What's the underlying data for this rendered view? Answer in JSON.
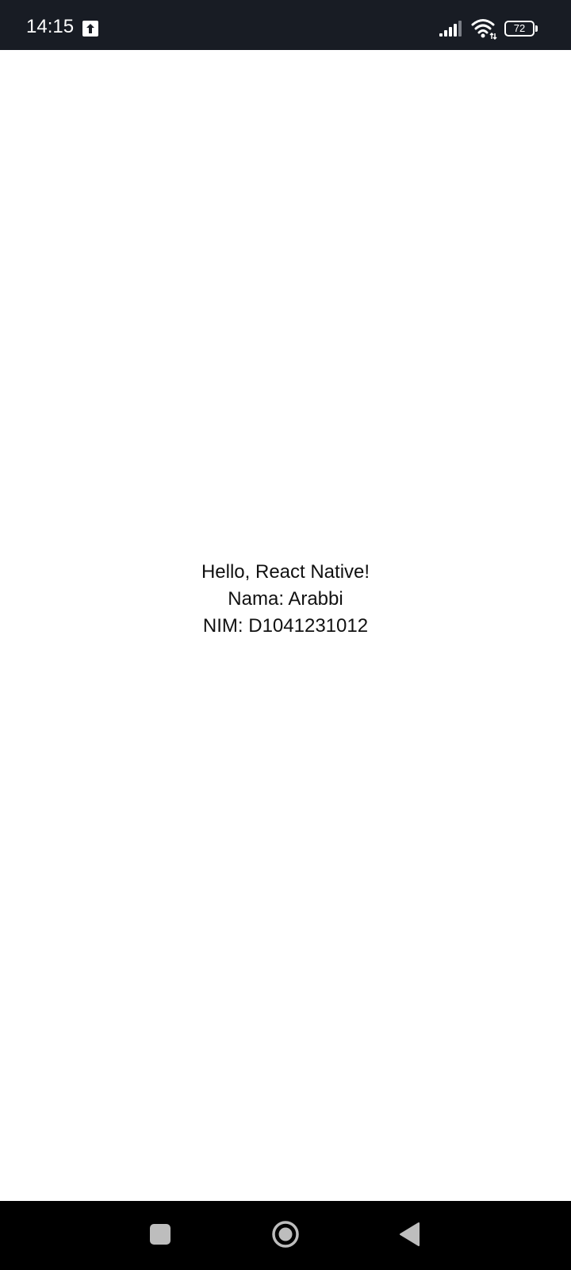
{
  "status_bar": {
    "time": "14:15",
    "battery_level": "72",
    "icons": [
      "upload-icon",
      "signal-icon",
      "wifi-icon",
      "battery-icon"
    ]
  },
  "main": {
    "lines": [
      "Hello, React Native!",
      "Nama: Arabbi",
      "NIM: D1041231012"
    ]
  },
  "nav_bar": {
    "buttons": [
      "recents-button",
      "home-button",
      "back-button"
    ]
  },
  "colors": {
    "status_bar_bg": "#181c24",
    "content_bg": "#ffffff",
    "nav_bar_bg": "#000000",
    "nav_icon": "#bdbdbd",
    "text": "#111111"
  }
}
